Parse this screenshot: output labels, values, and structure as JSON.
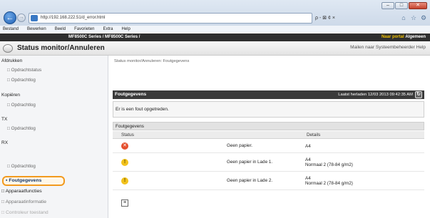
{
  "browser": {
    "url": "http://192.168.222.51/d_error.html",
    "search_placeholder": "ρ - ⊠ ¢ ×",
    "menu": [
      "Bestand",
      "Bewerken",
      "Beeld",
      "Favorieten",
      "Extra",
      "Help"
    ]
  },
  "header": {
    "brand": "",
    "model": "MF8500C Series / MF8500C Series /",
    "link_portal": "Naar portal",
    "link_general": "Algemeen"
  },
  "title": {
    "text": "Status monitor/Annuleren",
    "right_links": "Mailen naar Systeembeheerder  Help"
  },
  "sidebar": {
    "groups": [
      {
        "label": "Afdrukken",
        "items": [
          "Opdrachtstatus",
          "Opdrachtlog"
        ]
      },
      {
        "label": "Kopiëren",
        "items": [
          "Opdrachtlog"
        ]
      },
      {
        "label": "TX",
        "items": [
          "Opdrachtlog"
        ]
      },
      {
        "label": "RX",
        "items": [
          "Opdrachtlog"
        ]
      }
    ],
    "active": "Foutgegevens",
    "bottom_items": [
      "Apparaatfuncties",
      "Apparaatinformatie",
      "Controleur toestand"
    ]
  },
  "main": {
    "breadcrumb": "Status monitor/Annuleren: Foutgegevens",
    "panel_title": "Foutgegevens",
    "last_updated": "Laatst herladen 12/03 2013 09:42:35 AM",
    "error_message": "Er is een fout opgetreden.",
    "table_title": "Foutgegevens",
    "columns": {
      "status": "Status",
      "details": "Details"
    },
    "rows": [
      {
        "status_icon": "error-icon",
        "description": "Geen papier.",
        "details_line1": "A4",
        "details_line2": ""
      },
      {
        "status_icon": "warning-icon",
        "description": "Geen papier in Lade 1.",
        "details_line1": "A4",
        "details_line2": "Normaal 2 (78-84 g/m2)"
      },
      {
        "status_icon": "warning-icon",
        "description": "Geen papier in Lade 2.",
        "details_line1": "A4",
        "details_line2": "Normaal 2 (78-84 g/m2)"
      }
    ]
  },
  "colors": {
    "header_dark": "#2e2e2e",
    "accent_yellow": "#f0c000",
    "highlight_orange": "#f29a1e",
    "error_red": "#e5502e",
    "warning_yellow": "#f2c21c"
  }
}
